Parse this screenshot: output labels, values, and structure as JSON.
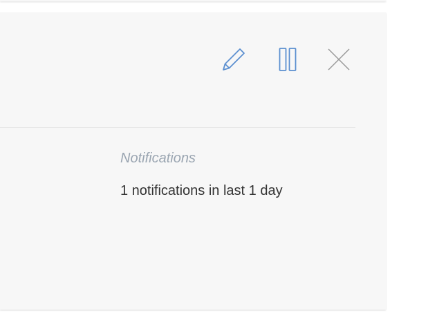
{
  "toolbar": {
    "edit_icon": "pencil-icon",
    "pause_icon": "pause-icon",
    "close_icon": "close-icon"
  },
  "stat": {
    "label": "Notifications",
    "value": "1 notifications in last 1 day"
  },
  "colors": {
    "icon_blue": "#5b8fd0",
    "icon_gray": "#9a9a9a",
    "card_bg": "#f7f7f7",
    "label": "#9aa5b1",
    "text": "#333333"
  }
}
